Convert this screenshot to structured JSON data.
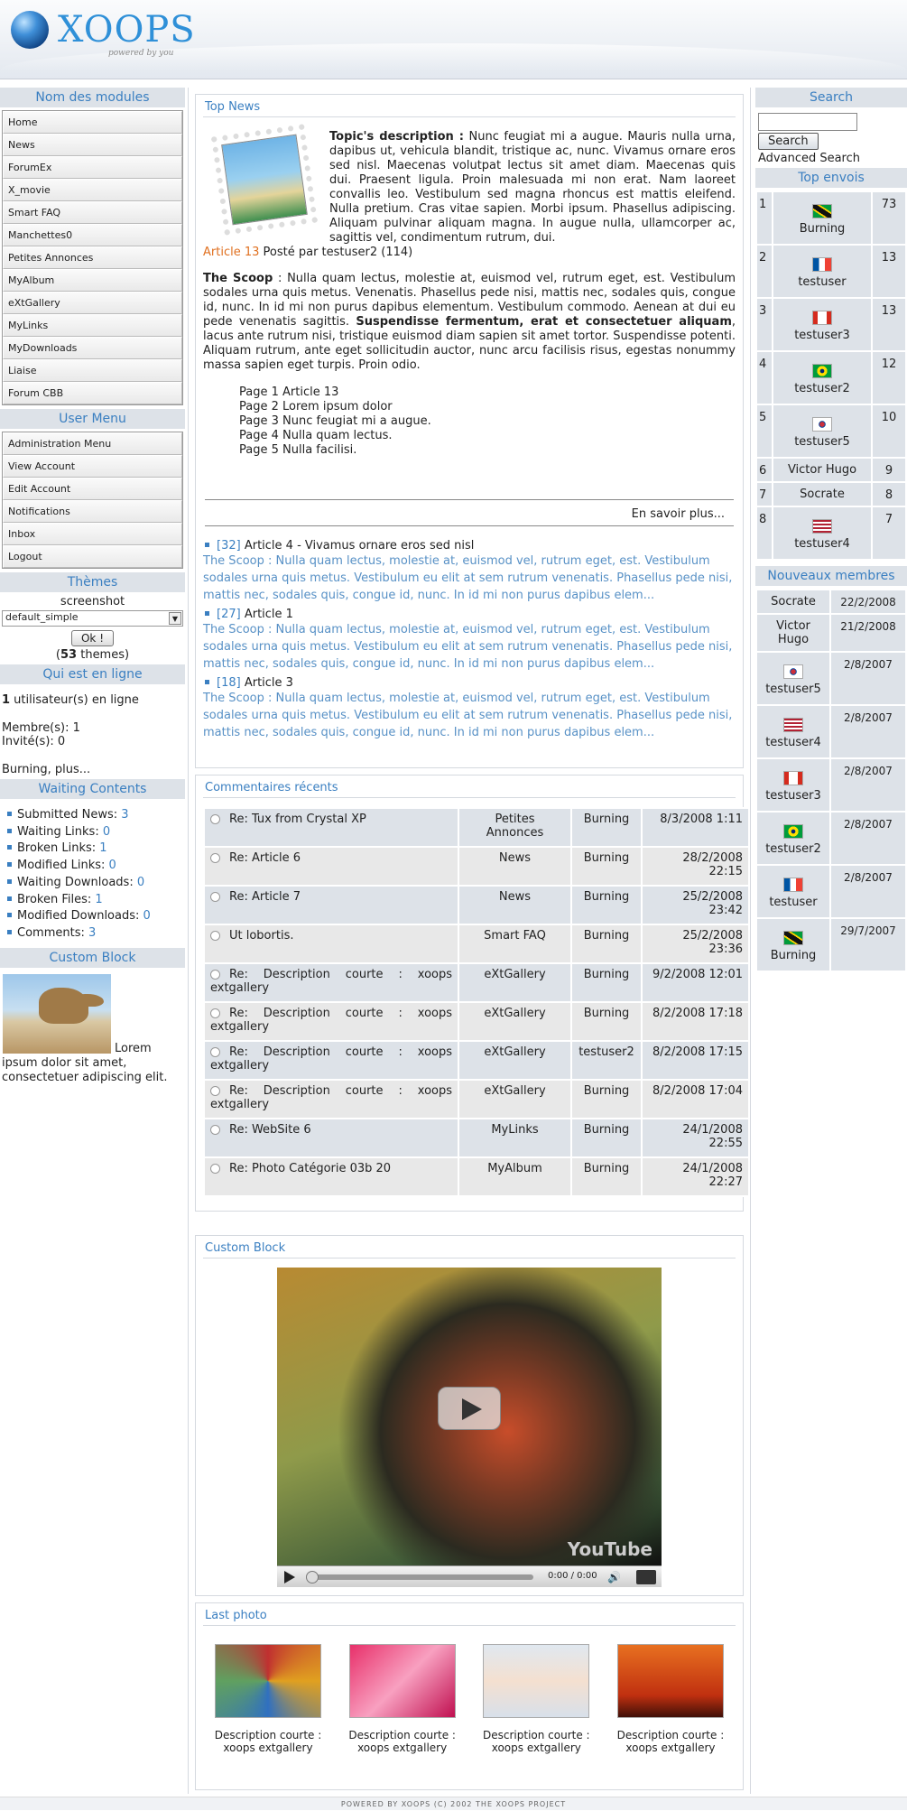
{
  "header": {
    "logo_text": "XOOPS",
    "logo_tagline": "powered by you"
  },
  "left": {
    "modules_title": "Nom des modules",
    "modules": [
      "Home",
      "News",
      "ForumEx",
      "X_movie",
      "Smart FAQ",
      "Manchettes0",
      "Petites Annonces",
      "MyAlbum",
      "eXtGallery",
      "MyLinks",
      "MyDownloads",
      "Liaise",
      "Forum CBB"
    ],
    "usermenu_title": "User Menu",
    "usermenu": [
      "Administration Menu",
      "View Account",
      "Edit Account",
      "Notifications",
      "Inbox",
      "Logout"
    ],
    "themes_title": "Thèmes",
    "themes_label": "screenshot",
    "themes_selected": "default_simple",
    "themes_ok": "Ok !",
    "themes_count": "53",
    "themes_suffix": " themes)",
    "themes_prefix": "(",
    "online_title": "Qui est en ligne",
    "online_count": "1",
    "online_text": " utilisateur(s) en ligne",
    "online_members": "Membre(s): 1",
    "online_guests": "Invité(s): 0",
    "online_list": "Burning, plus...",
    "waiting_title": "Waiting Contents",
    "waiting": [
      {
        "label": "Submitted News",
        "value": "3"
      },
      {
        "label": "Waiting Links",
        "value": "0"
      },
      {
        "label": "Broken Links",
        "value": "1"
      },
      {
        "label": "Modified Links",
        "value": "0"
      },
      {
        "label": "Waiting Downloads",
        "value": "0"
      },
      {
        "label": "Broken Files",
        "value": "1"
      },
      {
        "label": "Modified Downloads",
        "value": "0"
      },
      {
        "label": "Comments",
        "value": "3"
      }
    ],
    "custom_title": "Custom Block",
    "custom_text": "Lorem ipsum dolor sit amet, consectetuer adipiscing elit."
  },
  "center": {
    "topnews_title": "Top News",
    "topic_label": "Topic's description :",
    "topic_text": " Nunc feugiat mi a augue. Mauris nulla urna, dapibus ut, vehicula blandit, tristique ac, nunc. Vivamus ornare eros sed nisl. Maecenas volutpat lectus sit amet diam. Maecenas quis dui. Praesent ligula. Proin malesuada mi non erat. Nam laoreet convallis leo. Vestibulum sed magna rhoncus est mattis eleifend. Nulla pretium. Cras vitae sapien. Morbi ipsum. Phasellus adipiscing. Aliquam pulvinar aliquam magna. In augue nulla, ullamcorper ac, sagittis vel, condimentum rutrum, dui.",
    "article_link": "Article 13",
    "article_meta": " Posté par testuser2 (114)",
    "scoop_label": "The Scoop",
    "scoop_text1": " : Nulla quam lectus, molestie at, euismod vel, rutrum eget, est. Vestibulum sodales urna quis metus. Venenatis. Phasellus pede nisi, mattis nec, sodales quis, congue id, nunc. In id mi non purus dapibus elementum. Vestibulum commodo. Aenean at dui eu pede venenatis sagittis. ",
    "scoop_bold": "Suspendisse fermentum, erat et consectetuer aliquam",
    "scoop_text2": ", lacus ante rutrum nisi, tristique euismod diam sapien sit amet tortor. Suspendisse potenti. Aliquam rutrum, ante eget sollicitudin auctor, nunc arcu facilisis risus, egestas nonummy massa sapien eget turpis. Proin odio.",
    "pages": [
      "Page 1 Article 13",
      "Page 2 Lorem ipsum dolor",
      "Page 3 Nunc feugiat mi a augue.",
      "Page 4 Nulla quam lectus.",
      "Page 5 Nulla facilisi."
    ],
    "readmore": "En savoir plus...",
    "related": [
      {
        "count": "[32]",
        "title": "Article 4 - Vivamus ornare eros sed nisl",
        "text": "The Scoop : Nulla quam lectus, molestie at, euismod vel, rutrum eget, est. Vestibulum sodales urna quis metus. Vestibulum eu elit at sem rutrum venenatis. Phasellus pede nisi, mattis nec, sodales quis, congue id, nunc. In id mi non purus dapibus elem..."
      },
      {
        "count": "[27]",
        "title": "Article 1",
        "text": "The Scoop : Nulla quam lectus, molestie at, euismod vel, rutrum eget, est. Vestibulum sodales urna quis metus. Vestibulum eu elit at sem rutrum venenatis. Phasellus pede nisi, mattis nec, sodales quis, congue id, nunc. In id mi non purus dapibus elem..."
      },
      {
        "count": "[18]",
        "title": "Article 3",
        "text": "The Scoop : Nulla quam lectus, molestie at, euismod vel, rutrum eget, est. Vestibulum sodales urna quis metus. Vestibulum eu elit at sem rutrum venenatis. Phasellus pede nisi, mattis nec, sodales quis, congue id, nunc. In id mi non purus dapibus elem..."
      }
    ],
    "comments_title": "Commentaires récents",
    "comments": [
      {
        "title": "Re: Tux from Crystal XP",
        "module": "Petites Annonces",
        "user": "Burning",
        "date": "8/3/2008 1:11"
      },
      {
        "title": "Re: Article 6",
        "module": "News",
        "user": "Burning",
        "date": "28/2/2008 22:15"
      },
      {
        "title": "Re: Article 7",
        "module": "News",
        "user": "Burning",
        "date": "25/2/2008 23:42"
      },
      {
        "title": "Ut lobortis.",
        "module": "Smart FAQ",
        "user": "Burning",
        "date": "25/2/2008 23:36"
      },
      {
        "title": "Re: Description courte : xoops extgallery",
        "module": "eXtGallery",
        "user": "Burning",
        "date": "9/2/2008 12:01"
      },
      {
        "title": "Re: Description courte : xoops extgallery",
        "module": "eXtGallery",
        "user": "Burning",
        "date": "8/2/2008 17:18"
      },
      {
        "title": "Re: Description courte : xoops extgallery",
        "module": "eXtGallery",
        "user": "testuser2",
        "date": "8/2/2008 17:15"
      },
      {
        "title": "Re: Description courte : xoops extgallery",
        "module": "eXtGallery",
        "user": "Burning",
        "date": "8/2/2008 17:04"
      },
      {
        "title": "Re: WebSite 6",
        "module": "MyLinks",
        "user": "Burning",
        "date": "24/1/2008 22:55"
      },
      {
        "title": "Re: Photo Catégorie 03b 20",
        "module": "MyAlbum",
        "user": "Burning",
        "date": "24/1/2008 22:27"
      }
    ],
    "video_title": "Custom Block",
    "video_time": "0:00 / 0:00",
    "video_brand": "YouTube",
    "photos_title": "Last photo",
    "photos": [
      "Description courte : xoops extgallery",
      "Description courte : xoops extgallery",
      "Description courte : xoops extgallery",
      "Description courte : xoops extgallery"
    ]
  },
  "right": {
    "search_title": "Search",
    "search_button": "Search",
    "search_value": "",
    "advanced": "Advanced Search",
    "top_title": "Top envois",
    "top": [
      {
        "rank": "1",
        "name": "Burning",
        "count": "73",
        "flag": "jamaica"
      },
      {
        "rank": "2",
        "name": "testuser",
        "count": "13",
        "flag": "france"
      },
      {
        "rank": "3",
        "name": "testuser3",
        "count": "13",
        "flag": "canada"
      },
      {
        "rank": "4",
        "name": "testuser2",
        "count": "12",
        "flag": "brazil"
      },
      {
        "rank": "5",
        "name": "testuser5",
        "count": "10",
        "flag": "korea"
      },
      {
        "rank": "6",
        "name": "Victor Hugo",
        "count": "9",
        "flag": ""
      },
      {
        "rank": "7",
        "name": "Socrate",
        "count": "8",
        "flag": ""
      },
      {
        "rank": "8",
        "name": "testuser4",
        "count": "7",
        "flag": "usa"
      }
    ],
    "new_title": "Nouveaux membres",
    "new": [
      {
        "name": "Socrate",
        "date": "22/2/2008",
        "flag": ""
      },
      {
        "name": "Victor Hugo",
        "date": "21/2/2008",
        "flag": ""
      },
      {
        "name": "testuser5",
        "date": "2/8/2007",
        "flag": "korea"
      },
      {
        "name": "testuser4",
        "date": "2/8/2007",
        "flag": "usa"
      },
      {
        "name": "testuser3",
        "date": "2/8/2007",
        "flag": "canada"
      },
      {
        "name": "testuser2",
        "date": "2/8/2007",
        "flag": "brazil"
      },
      {
        "name": "testuser",
        "date": "2/8/2007",
        "flag": "france"
      },
      {
        "name": "Burning",
        "date": "29/7/2007",
        "flag": "jamaica"
      }
    ]
  },
  "footer": "POWERED BY XOOPS (C) 2002 THE XOOPS PROJECT"
}
